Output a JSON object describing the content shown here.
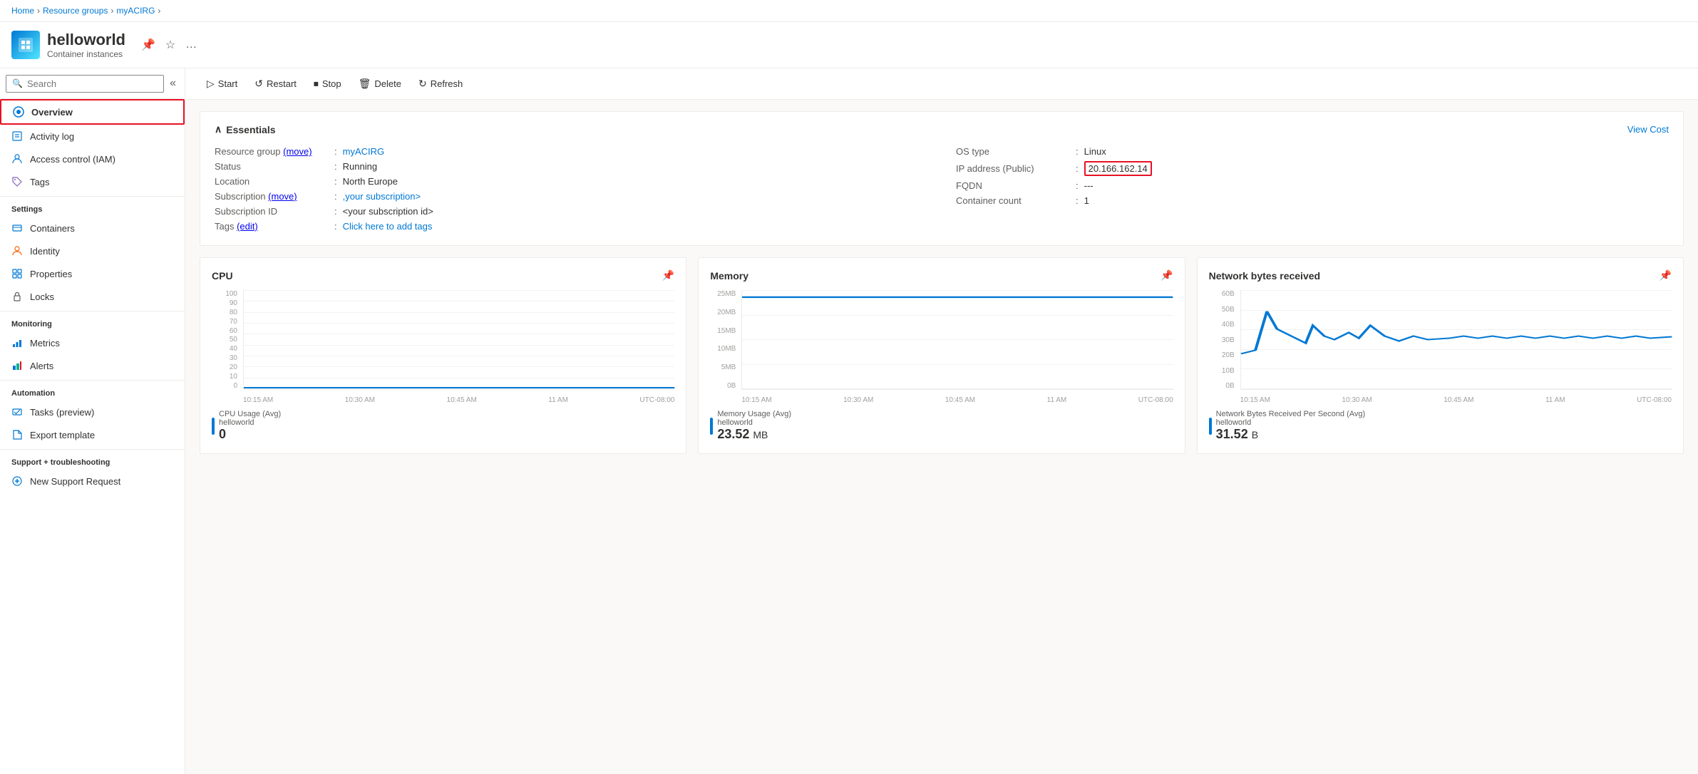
{
  "breadcrumb": {
    "home": "Home",
    "resource_groups": "Resource groups",
    "myACIRG": "myACIRG"
  },
  "header": {
    "title": "helloworld",
    "subtitle": "Container instances",
    "pin_tooltip": "Pin to dashboard",
    "favorite_tooltip": "Favorite",
    "more_tooltip": "More"
  },
  "toolbar": {
    "start": "Start",
    "restart": "Restart",
    "stop": "Stop",
    "delete": "Delete",
    "refresh": "Refresh"
  },
  "sidebar": {
    "search_placeholder": "Search",
    "items": [
      {
        "id": "overview",
        "label": "Overview",
        "active": true
      },
      {
        "id": "activity-log",
        "label": "Activity log"
      },
      {
        "id": "access-control",
        "label": "Access control (IAM)"
      },
      {
        "id": "tags",
        "label": "Tags"
      }
    ],
    "sections": [
      {
        "title": "Settings",
        "items": [
          {
            "id": "containers",
            "label": "Containers"
          },
          {
            "id": "identity",
            "label": "Identity"
          },
          {
            "id": "properties",
            "label": "Properties"
          },
          {
            "id": "locks",
            "label": "Locks"
          }
        ]
      },
      {
        "title": "Monitoring",
        "items": [
          {
            "id": "metrics",
            "label": "Metrics"
          },
          {
            "id": "alerts",
            "label": "Alerts"
          }
        ]
      },
      {
        "title": "Automation",
        "items": [
          {
            "id": "tasks",
            "label": "Tasks (preview)"
          },
          {
            "id": "export-template",
            "label": "Export template"
          }
        ]
      },
      {
        "title": "Support + troubleshooting",
        "items": [
          {
            "id": "new-support",
            "label": "New Support Request"
          }
        ]
      }
    ]
  },
  "essentials": {
    "title": "Essentials",
    "view_cost": "View Cost",
    "fields_left": [
      {
        "label": "Resource group (move)",
        "value": "myACIRG",
        "link": true
      },
      {
        "label": "Status",
        "value": "Running"
      },
      {
        "label": "Location",
        "value": "North Europe"
      },
      {
        "label": "Subscription (move)",
        "value": ",your subscription>",
        "link": true
      },
      {
        "label": "Subscription ID",
        "value": "<your subscription id>"
      },
      {
        "label": "Tags (edit)",
        "value": "Click here to add tags",
        "link": true
      }
    ],
    "fields_right": [
      {
        "label": "OS type",
        "value": "Linux"
      },
      {
        "label": "IP address (Public)",
        "value": "20.166.162.14",
        "highlight": true
      },
      {
        "label": "FQDN",
        "value": "---"
      },
      {
        "label": "Container count",
        "value": "1"
      }
    ]
  },
  "charts": [
    {
      "id": "cpu",
      "title": "CPU",
      "y_labels": [
        "100",
        "90",
        "80",
        "70",
        "60",
        "50",
        "40",
        "30",
        "20",
        "10",
        "0"
      ],
      "x_labels": [
        "10:15 AM",
        "10:30 AM",
        "10:45 AM",
        "11 AM",
        "UTC-08:00"
      ],
      "legend_label": "CPU Usage (Avg)",
      "legend_sub": "helloworld",
      "value": "0",
      "line_data": "flat_bottom"
    },
    {
      "id": "memory",
      "title": "Memory",
      "y_labels": [
        "25MB",
        "20MB",
        "15MB",
        "10MB",
        "5MB",
        "0B"
      ],
      "x_labels": [
        "10:15 AM",
        "10:30 AM",
        "10:45 AM",
        "11 AM",
        "UTC-08:00"
      ],
      "legend_label": "Memory Usage (Avg)",
      "legend_sub": "helloworld",
      "value": "23.52 MB",
      "line_data": "high_flat"
    },
    {
      "id": "network",
      "title": "Network bytes received",
      "y_labels": [
        "60B",
        "50B",
        "40B",
        "30B",
        "20B",
        "10B",
        "0B"
      ],
      "x_labels": [
        "10:15 AM",
        "10:30 AM",
        "10:45 AM",
        "11 AM",
        "UTC-08:00"
      ],
      "legend_label": "Network Bytes Received Per Second (Avg)",
      "legend_sub": "helloworld",
      "value": "31.52 B",
      "line_data": "spiky"
    }
  ]
}
